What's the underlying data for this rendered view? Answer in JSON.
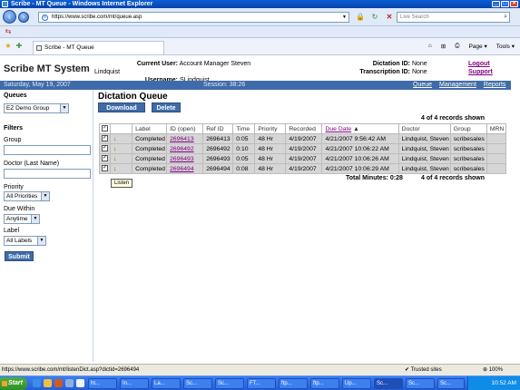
{
  "window": {
    "title": "Scribe - MT Queue - Windows Internet Explorer"
  },
  "browser": {
    "url": "https://www.scribe.com/mt/queue.asp",
    "search_placeholder": "Live Search",
    "tab_label": "Scribe - MT Queue",
    "tools": [
      "Page",
      "Tools"
    ]
  },
  "app": {
    "brand": "Scribe MT System",
    "current_user_label": "Current User:",
    "current_user_value": "Account Manager Steven Lindquist",
    "username_label": "Username:",
    "username_value": "SLindquist",
    "dictation_label": "Dictation ID:",
    "dictation_value": "None",
    "transcription_label": "Transcription ID:",
    "transcription_value": "None",
    "logout": "Logout",
    "support": "Support"
  },
  "bar": {
    "date": "Saturday, May 19, 2007",
    "session": "Session: 38:26",
    "links": [
      "Queue",
      "Management",
      "Reports"
    ]
  },
  "sidebar": {
    "queues_heading": "Queues",
    "queue_selected": "EZ Demo Group",
    "filters_heading": "Filters",
    "group_label": "Group",
    "doctor_label": "Doctor (Last Name)",
    "priority_label": "Priority",
    "priority_selected": "All Priorities",
    "due_label": "Due Within",
    "due_selected": "Anytime",
    "label_label": "Label",
    "label_selected": "All Labels",
    "submit": "Submit"
  },
  "main": {
    "title": "Dictation Queue",
    "download": "Download",
    "delete": "Delete",
    "records_shown": "4 of 4 records shown",
    "columns": [
      "",
      "",
      "Label",
      "ID (open)",
      "Ref ID",
      "Time",
      "Priority",
      "Recorded",
      "Due Date",
      "Doctor",
      "Group",
      "MRN"
    ],
    "rows": [
      {
        "label": "Completed",
        "id": "2696413",
        "ref": "2696413",
        "time": "0:05",
        "priority": "48 Hr",
        "recorded": "4/19/2007",
        "due": "4/21/2007 9:56:42 AM",
        "doctor": "Lindquist, Steven",
        "group": "scribesales",
        "mrn": ""
      },
      {
        "label": "Completed",
        "id": "2696492",
        "ref": "2696492",
        "time": "0:10",
        "priority": "48 Hr",
        "recorded": "4/19/2007",
        "due": "4/21/2007 10:06:22 AM",
        "doctor": "Lindquist, Steven",
        "group": "scribesales",
        "mrn": ""
      },
      {
        "label": "Completed",
        "id": "2696493",
        "ref": "2696493",
        "time": "0:05",
        "priority": "48 Hr",
        "recorded": "4/19/2007",
        "due": "4/21/2007 10:06:26 AM",
        "doctor": "Lindquist, Steven",
        "group": "scribesales",
        "mrn": ""
      },
      {
        "label": "Completed",
        "id": "2696494",
        "ref": "2696494",
        "time": "0:08",
        "priority": "48 Hr",
        "recorded": "4/19/2007",
        "due": "4/21/2007 10:06:29 AM",
        "doctor": "Lindquist, Steven",
        "group": "scribesales",
        "mrn": ""
      }
    ],
    "total_minutes": "Total Minutes: 0:28",
    "records_shown_bottom": "4 of 4 records shown",
    "tooltip": "Listen"
  },
  "status": {
    "url": "https://www.scribe.com/mt/listenDict.asp?dictid=2696494",
    "zone": "Trusted sites",
    "zoom": "100%"
  },
  "taskbar": {
    "start": "Start",
    "buttons": [
      "ht...",
      "In...",
      "La...",
      "Sc...",
      "Sc...",
      "FT...",
      "ftp...",
      "ftp...",
      "Up...",
      "Sc...",
      "Sc...",
      "Sc..."
    ],
    "clock": "10:52 AM"
  }
}
